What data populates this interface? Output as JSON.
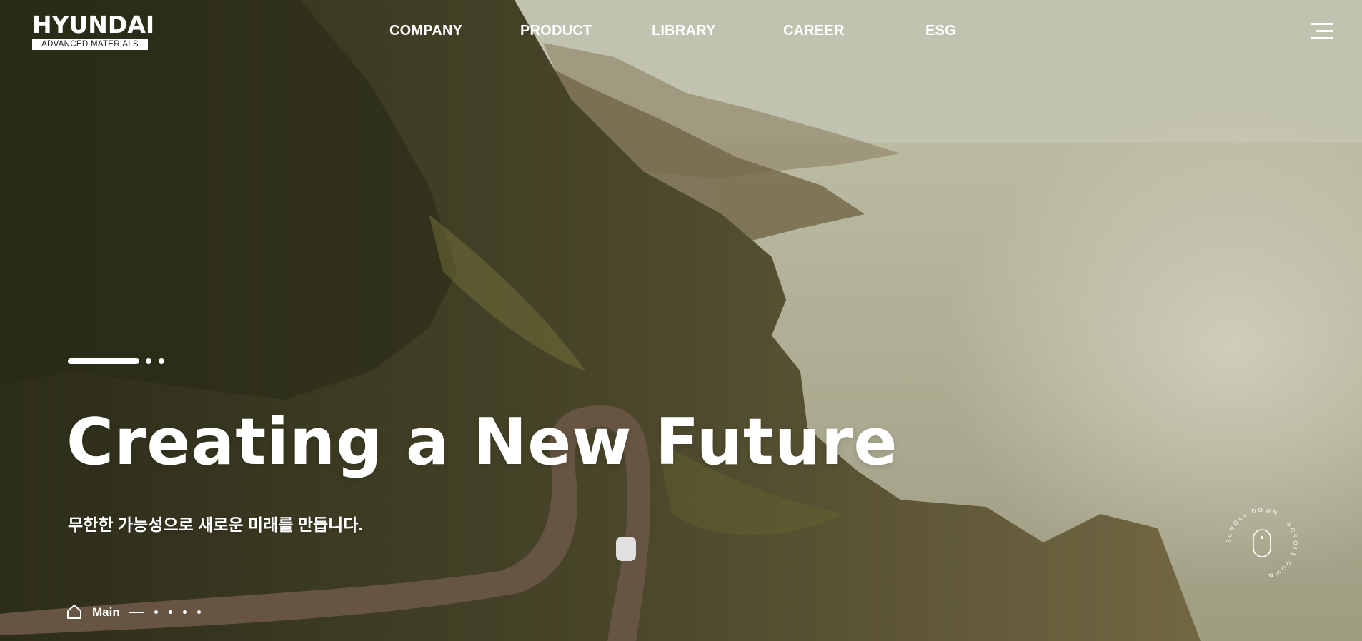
{
  "logo": {
    "main": "HYUNDAI",
    "sub": "ADVANCED MATERIALS"
  },
  "nav": {
    "items": [
      "COMPANY",
      "PRODUCT",
      "LIBRARY",
      "CAREER",
      "ESG"
    ]
  },
  "menu": {
    "icon": "hamburger-menu-icon"
  },
  "hero": {
    "headline": "Creating a New Future",
    "subtitle": "무한한 가능성으로 새로운 미래를 만듭니다.",
    "slide_count": 3,
    "active_slide": 1
  },
  "bottom_nav": {
    "home_icon": "home-icon",
    "label": "Main",
    "section_count": 4
  },
  "scroll": {
    "text": "SCROLL DOWN · SCROLL DOWN",
    "icon": "mouse-icon"
  },
  "colors": {
    "text": "#ffffff",
    "sky": "#cfcfba",
    "cliff": "#3a3a22"
  }
}
